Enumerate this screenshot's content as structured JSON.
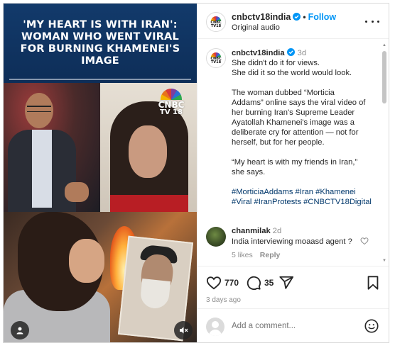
{
  "media": {
    "headline": "'MY HEART IS WITH IRAN': WOMAN WHO WENT VIRAL FOR BURNING KHAMENEI'S IMAGE",
    "logo_line1": "CNBC",
    "logo_line2": "TV 18"
  },
  "header": {
    "username": "cnbctv18india",
    "separator": "•",
    "follow_label": "Follow",
    "audio": "Original audio",
    "avatar_text_line1": "CNBC",
    "avatar_text_line2": "TV18"
  },
  "caption": {
    "username": "cnbctv18india",
    "time": "3d",
    "lines": [
      "She didn't do it for views.",
      "She did it so the world would look.",
      "",
      "The woman dubbed “Morticia",
      "Addams” online says the viral video of",
      "her burning Iran's Supreme Leader",
      "Ayatollah Khamenei's image was a",
      "deliberate cry for attention — not for",
      "herself, but for her people.",
      "",
      "“My heart is with my friends in Iran,”",
      "she says."
    ],
    "hashtags_line1": "#MorticiaAddams #Iran #Khamenei",
    "hashtags_line2": "#Viral #IranProtests #CNBCTV18Digital"
  },
  "comment": {
    "username": "chanmilak",
    "time": "2d",
    "text": "India interviewing moaasd agent ?",
    "likes": "5 likes",
    "reply_label": "Reply"
  },
  "actions": {
    "like_count": "770",
    "comment_count": "35",
    "date": "3 days ago"
  },
  "add_comment": {
    "placeholder": "Add a comment..."
  },
  "colors": {
    "link_blue": "#0095f6",
    "hashtag_blue": "#00376b",
    "verified_blue": "#0095f6",
    "headline_band": "#123a6b"
  },
  "icons": [
    "user-tag-icon",
    "mute-icon",
    "verified-icon",
    "more-icon",
    "heart-icon",
    "comment-icon",
    "share-icon",
    "bookmark-icon",
    "emoji-icon",
    "scroll-up-icon",
    "scroll-down-icon"
  ]
}
